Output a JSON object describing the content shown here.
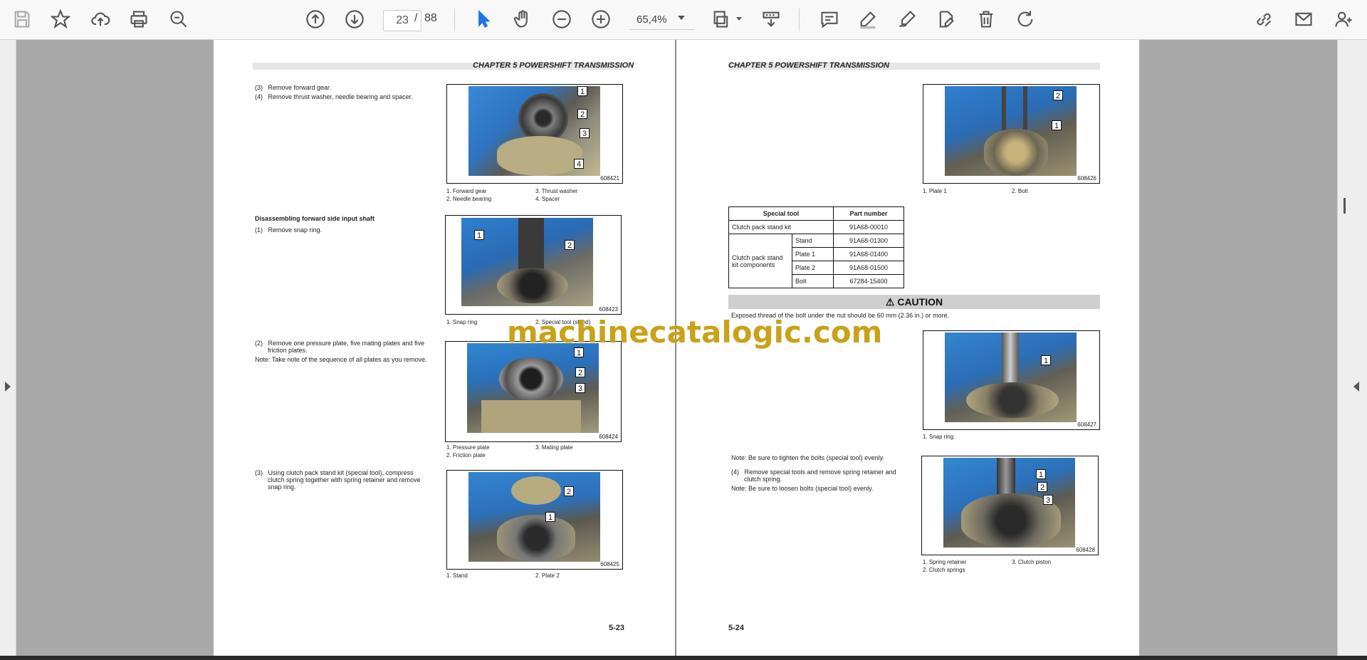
{
  "toolbar": {
    "icons": [
      "save-icon",
      "bookmark-star-icon",
      "upload-cloud-icon",
      "print-icon",
      "zoom-search-icon",
      "page-up-icon",
      "page-down-icon",
      "select-cursor-icon",
      "hand-pan-icon",
      "zoom-out-icon",
      "zoom-in-icon",
      "fit-page-icon",
      "scroll-mode-icon",
      "comment-icon",
      "highlight-pen-icon",
      "draw-sign-icon",
      "edit-pdf-icon",
      "delete-icon",
      "rotate-icon",
      "share-link-icon",
      "email-icon",
      "add-user-icon"
    ],
    "current_page": "23",
    "page_separator": "/",
    "total_pages": "88",
    "zoom": "65,4%"
  },
  "watermark": "machinecatalogic.com",
  "left_page": {
    "chapter": "CHAPTER 5 POWERSHIFT TRANSMISSION",
    "step3": "(3)   Remove forward gear.",
    "step4": "(4)   Remove thrust washer, needle bearing and spacer.",
    "fig1_num": "608421",
    "fig1_caps": [
      "1. Forward gear",
      "3. Thrust washer",
      "2. Needle bearing",
      "4. Spacer"
    ],
    "heading": "Disassembling forward side input shaft",
    "step1": "(1)   Remove snap ring.",
    "fig2_num": "608423",
    "fig2_caps": [
      "1. Snap ring",
      "2. Special tool (stand)"
    ],
    "step2a": "(2)   Remove one pressure plate, five mating plates and five",
    "step2b": "friction plates.",
    "note1": "Note: Take note of the sequence of all plates as you remove.",
    "fig3_num": "608424",
    "fig3_caps": [
      "1. Pressure plate",
      "3. Mating plate",
      "2. Friction plate"
    ],
    "step3b_a": "(3)   Using clutch pack stand kit (special tool), compress",
    "step3b_b": "clutch spring together with spring retainer and remove",
    "step3b_c": "snap ring.",
    "fig4_num": "608425",
    "fig4_caps": [
      "1. Stand",
      "2. Plate 2"
    ],
    "page_number": "5-23"
  },
  "right_page": {
    "chapter": "CHAPTER 5 POWERSHIFT TRANSMISSION",
    "fig5_num": "608426",
    "fig5_caps": [
      "1. Plate 1",
      "2. Bolt"
    ],
    "table": {
      "headers": [
        "Special tool",
        "Part number"
      ],
      "row1": [
        "Clutch pack stand kit",
        "91A68-00010"
      ],
      "group_label": "Clutch pack stand kit components",
      "sub_rows": [
        [
          "Stand",
          "91A68-01300"
        ],
        [
          "Plate 1",
          "91A68-01400"
        ],
        [
          "Plate 2",
          "91A68-01500"
        ],
        [
          "Bolt",
          "67284-15400"
        ]
      ]
    },
    "caution_title": "CAUTION",
    "caution_text": "Exposed thread of the bolt under the nut should be 60 mm (2.36 in.) or more.",
    "fig6_num": "608427",
    "fig6_caps": [
      "1. Snap ring"
    ],
    "note2": "Note: Be sure to tighten the bolts (special tool) evenly.",
    "step4a": "(4)   Remove special tools and remove spring retainer and",
    "step4b": "clutch spring.",
    "note3": "Note: Be sure to loosen bolts (special tool) evenly.",
    "fig7_num": "608428",
    "fig7_caps": [
      "1. Spring retainer",
      "3. Clutch piston",
      "2. Clutch springs"
    ],
    "page_number": "5-24"
  },
  "callouts": [
    "1",
    "2",
    "3",
    "4"
  ]
}
